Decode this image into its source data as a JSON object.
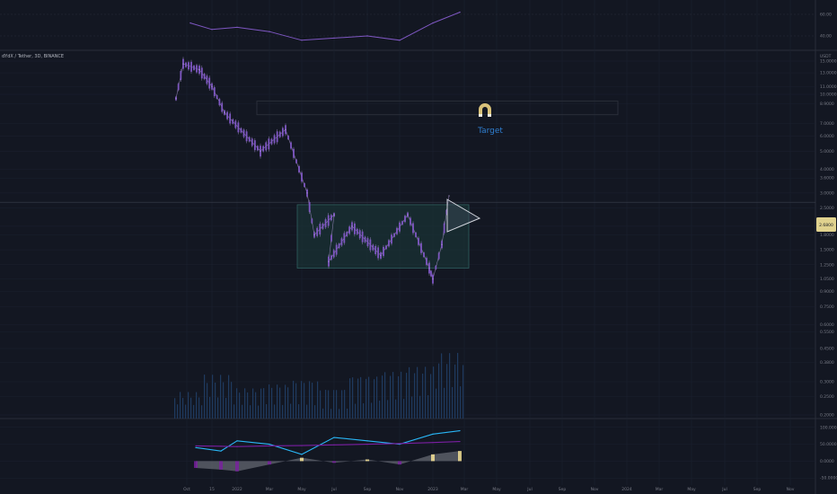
{
  "header": {
    "symbol_line": "dYdX / Tether, 3D, BINANCE",
    "currency": "USDT"
  },
  "colors": {
    "background": "#131722",
    "grid": "#1c2130",
    "candle": "#7e57c2",
    "wick": "#b39ddb",
    "range_box": "#1b3a3a",
    "target_line": "#2a2e39",
    "target_text": "#2f7fd1",
    "magnet": "#d9c27a",
    "rsi_line": "#7e57c2",
    "osc_cyan": "#29b6f6",
    "osc_purple": "#7b1fa2",
    "osc_yellow": "#ffeb9a",
    "osc_gray": "#787b86",
    "volume": "#1f3a5f",
    "price_tag_bg": "#e0d28e"
  },
  "annotations": {
    "target_label": "Target",
    "magnet_icon": "magnet-icon"
  },
  "chart_data": [
    {
      "type": "line",
      "title": "",
      "ylabel": "",
      "y_ticks": [
        "60.00",
        "40.00"
      ],
      "ylim": [
        30,
        70
      ],
      "x": [
        "Oct",
        "15",
        "2022",
        "Mar",
        "May",
        "Jul",
        "Sep",
        "Nov",
        "2023",
        "Mar"
      ],
      "values": [
        52,
        46,
        48,
        44,
        36,
        38,
        40,
        36,
        52,
        62
      ]
    },
    {
      "type": "line",
      "title": "dYdX / Tether, 3D, BINANCE",
      "ylabel": "USDT",
      "scale": "log",
      "y_ticks": [
        "15.0000",
        "13.0000",
        "11.0000",
        "10.0000",
        "8.9000",
        "7.0000",
        "6.0000",
        "5.0000",
        "4.0000",
        "3.6000",
        "3.0000",
        "2.5000",
        "2.0000",
        "1.8000",
        "1.5000",
        "1.2500",
        "1.0500",
        "0.9000",
        "0.7500",
        "0.6000",
        "0.5500",
        "0.4500",
        "0.3800",
        "0.3000",
        "0.2500",
        "0.2000"
      ],
      "ylim": [
        0.2,
        15
      ],
      "x_ticks": [
        "Oct",
        "15",
        "2022",
        "Mar",
        "May",
        "Jul",
        "Sep",
        "Nov",
        "2023",
        "Mar",
        "May",
        "Jul",
        "Sep",
        "Nov",
        "2024",
        "Mar",
        "May",
        "Jul",
        "Sep",
        "Nov"
      ],
      "price_series": [
        {
          "x": "Oct",
          "y": 9.5
        },
        {
          "x": "Oct",
          "y": 14.5
        },
        {
          "x": "15",
          "y": 13.5
        },
        {
          "x": "15",
          "y": 11.0
        },
        {
          "x": "2022",
          "y": 8.0
        },
        {
          "x": "Mar",
          "y": 5.0
        },
        {
          "x": "Mar",
          "y": 6.5
        },
        {
          "x": "May",
          "y": 3.0
        },
        {
          "x": "May",
          "y": 1.8
        },
        {
          "x": "Jul",
          "y": 2.3
        },
        {
          "x": "Jul",
          "y": 1.3
        },
        {
          "x": "Sep",
          "y": 2.0
        },
        {
          "x": "Sep",
          "y": 1.4
        },
        {
          "x": "Nov",
          "y": 2.3
        },
        {
          "x": "Nov",
          "y": 1.2
        },
        {
          "x": "2023",
          "y": 1.05
        },
        {
          "x": "2023",
          "y": 1.6
        },
        {
          "x": "Mar",
          "y": 2.9
        }
      ],
      "target_zone": {
        "y_low": 7.8,
        "y_high": 9.2,
        "label": "Target"
      },
      "range_box": {
        "y_low": 1.2,
        "y_high": 2.6
      },
      "current_price_tag": "2.6800",
      "volume": [
        0.3,
        0.5,
        0.35,
        0.4,
        0.45,
        0.35,
        0.5,
        0.55,
        0.6,
        0.75
      ]
    },
    {
      "type": "area",
      "title": "",
      "ylabel": "",
      "y_ticks": [
        "100.0000",
        "50.0000",
        "0.0000",
        "-50.0000"
      ],
      "ylim": [
        -60,
        110
      ],
      "x": [
        "Oct",
        "15",
        "2022",
        "Mar",
        "May",
        "Jul",
        "Sep",
        "Nov",
        "2023",
        "Mar"
      ],
      "series": [
        {
          "values": [
            40,
            30,
            60,
            50,
            20,
            70,
            60,
            50,
            80,
            90
          ]
        },
        {
          "values": [
            45,
            44,
            43,
            45,
            46,
            48,
            50,
            52,
            55,
            58
          ]
        },
        {
          "values": [
            -20,
            -25,
            -30,
            -10,
            10,
            -5,
            5,
            -10,
            20,
            30
          ]
        }
      ]
    }
  ]
}
